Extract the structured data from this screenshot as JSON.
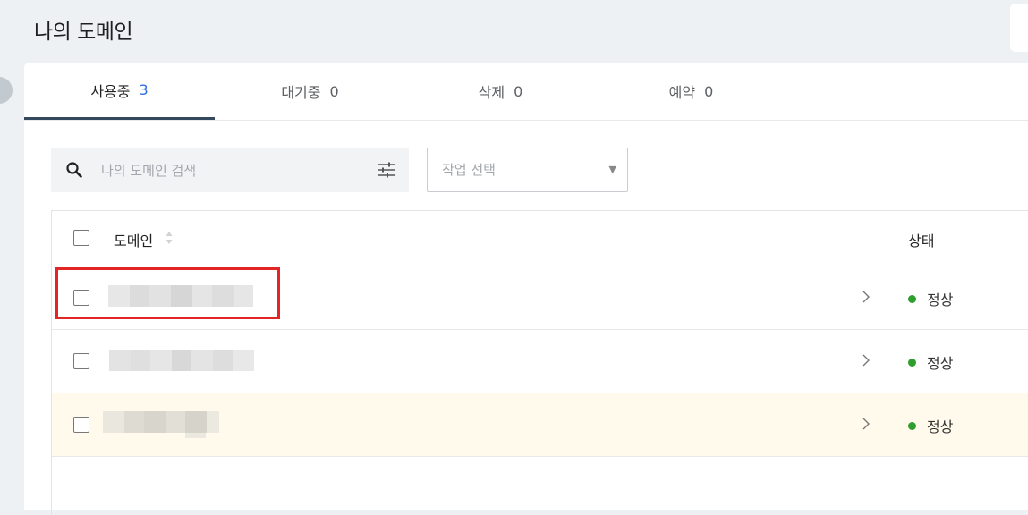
{
  "page": {
    "title": "나의 도메인"
  },
  "tabs": [
    {
      "label": "사용중",
      "count": "3",
      "active": true
    },
    {
      "label": "대기중",
      "count": "0",
      "active": false
    },
    {
      "label": "삭제",
      "count": "0",
      "active": false
    },
    {
      "label": "예약",
      "count": "0",
      "active": false
    }
  ],
  "search": {
    "placeholder": "나의 도메인 검색",
    "value": ""
  },
  "action_select": {
    "selected": "작업 선택"
  },
  "table": {
    "headers": {
      "domain": "도메인",
      "status": "상태"
    },
    "rows": [
      {
        "domain": "",
        "status": "정상",
        "status_color": "#2e9e2e",
        "highlighted": false
      },
      {
        "domain": "",
        "status": "정상",
        "status_color": "#2e9e2e",
        "highlighted": false
      },
      {
        "domain": "",
        "status": "정상",
        "status_color": "#2e9e2e",
        "highlighted": true
      }
    ]
  },
  "colors": {
    "accent": "#2f6fe4",
    "tab_underline": "#34495e",
    "status_ok": "#2e9e2e",
    "annotation_box": "#e32525",
    "row_highlight": "#fffaeb"
  }
}
